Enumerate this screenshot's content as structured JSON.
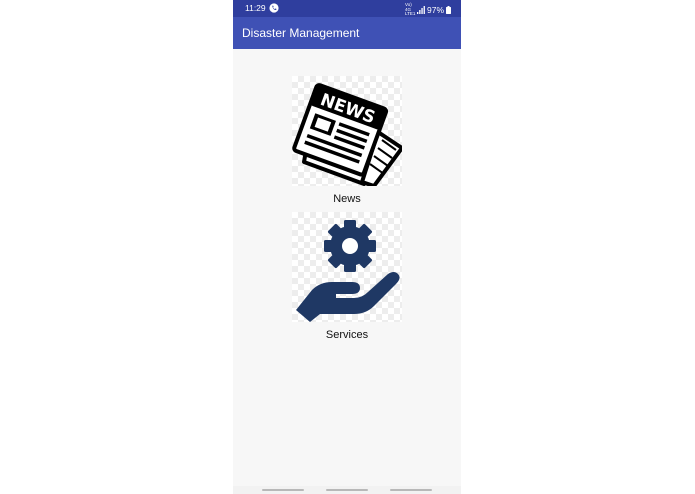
{
  "status_bar": {
    "time": "11:29",
    "network": "Vo) 4G LTE1",
    "battery": "97%"
  },
  "app_bar": {
    "title": "Disaster Management"
  },
  "menu": {
    "items": [
      {
        "label": "News",
        "icon": "newspaper-icon",
        "icon_text": "NEWS"
      },
      {
        "label": "Services",
        "icon": "hand-gear-icon"
      }
    ]
  },
  "colors": {
    "status_bar": "#2f3e9e",
    "app_bar": "#3f51b5",
    "services_icon": "#1f3864",
    "background": "#f7f7f7"
  }
}
